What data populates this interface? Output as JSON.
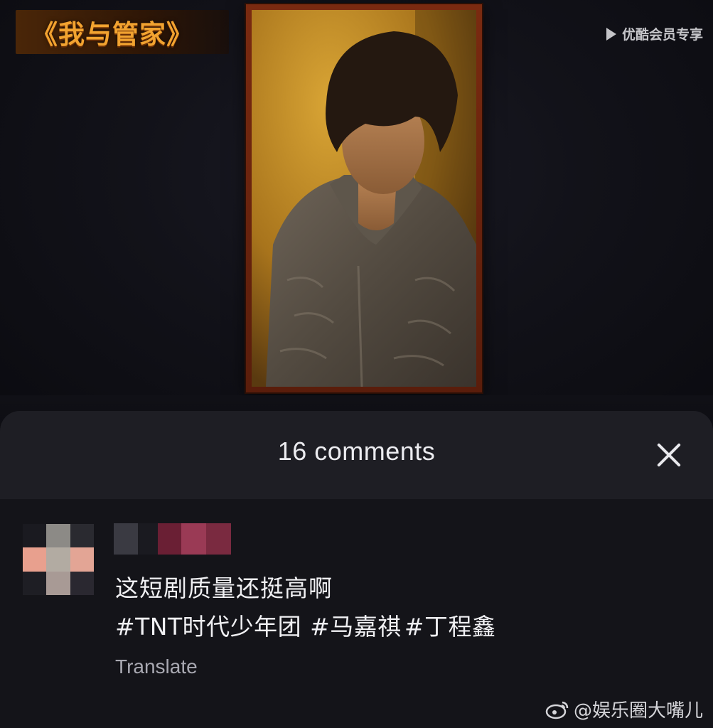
{
  "video": {
    "show_title": "《我与管家》",
    "platform_badge": "优酷会员专享",
    "poster_icon": "person-portrait-image"
  },
  "comments_sheet": {
    "count_label": "16 comments",
    "close_icon": "close-icon",
    "comment": {
      "text": "这短剧质量还挺高啊",
      "hashtags": [
        "#TNT时代少年团",
        "#马嘉祺",
        "#丁程鑫"
      ],
      "translate_label": "Translate"
    }
  },
  "watermark": {
    "text": "@娱乐圈大嘴儿",
    "icon": "weibo-icon"
  },
  "colors": {
    "title_orange": "#f2a330",
    "sheet_header": "#1e1e24",
    "sheet_body": "#141419",
    "text_primary": "#f0f0f3",
    "text_secondary": "#a9a9b2"
  }
}
